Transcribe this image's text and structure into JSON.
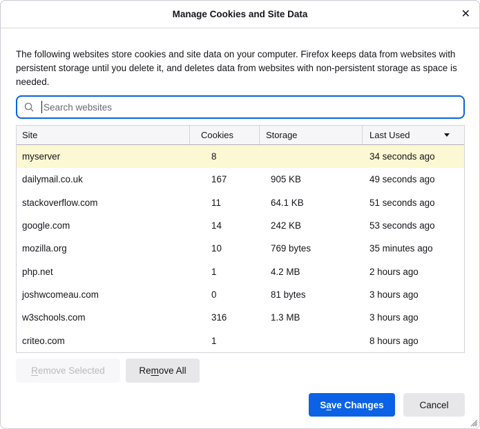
{
  "dialog": {
    "title": "Manage Cookies and Site Data",
    "close_glyph": "✕"
  },
  "description": "The following websites store cookies and site data on your computer. Firefox keeps data from websites with persistent storage until you delete it, and deletes data from websites with non-persistent storage as space is needed.",
  "search": {
    "placeholder": "Search websites",
    "value": ""
  },
  "table": {
    "columns": [
      "Site",
      "Cookies",
      "Storage",
      "Last Used"
    ],
    "sort": {
      "column": "Last Used",
      "direction": "descending"
    },
    "rows": [
      {
        "site": "myserver",
        "cookies": "8",
        "storage": "",
        "last_used": "34 seconds ago",
        "highlighted": true
      },
      {
        "site": "dailymail.co.uk",
        "cookies": "167",
        "storage": "905 KB",
        "last_used": "49 seconds ago",
        "highlighted": false
      },
      {
        "site": "stackoverflow.com",
        "cookies": "11",
        "storage": "64.1 KB",
        "last_used": "51 seconds ago",
        "highlighted": false
      },
      {
        "site": "google.com",
        "cookies": "14",
        "storage": "242 KB",
        "last_used": "53 seconds ago",
        "highlighted": false
      },
      {
        "site": "mozilla.org",
        "cookies": "10",
        "storage": "769 bytes",
        "last_used": "35 minutes ago",
        "highlighted": false
      },
      {
        "site": "php.net",
        "cookies": "1",
        "storage": "4.2 MB",
        "last_used": "2 hours ago",
        "highlighted": false
      },
      {
        "site": "joshwcomeau.com",
        "cookies": "0",
        "storage": "81 bytes",
        "last_used": "3 hours ago",
        "highlighted": false
      },
      {
        "site": "w3schools.com",
        "cookies": "316",
        "storage": "1.3 MB",
        "last_used": "3 hours ago",
        "highlighted": false
      },
      {
        "site": "criteo.com",
        "cookies": "1",
        "storage": "",
        "last_used": "8 hours ago",
        "highlighted": false
      }
    ]
  },
  "actions": {
    "remove_selected": {
      "label": "Remove Selected",
      "accesskey": "R",
      "enabled": false
    },
    "remove_all": {
      "label": "Remove All",
      "accesskey": "m",
      "enabled": true
    },
    "save_changes": {
      "label": "Save Changes",
      "accesskey": "a",
      "enabled": true
    },
    "cancel": {
      "label": "Cancel",
      "accesskey": "",
      "enabled": true
    }
  },
  "colors": {
    "accent_blue": "#0b62e4",
    "search_focus_border": "#0862e0",
    "highlight_row": "#fcf8d3",
    "header_bg": "#f6f6f8",
    "disabled_text": "#b9b9be"
  }
}
